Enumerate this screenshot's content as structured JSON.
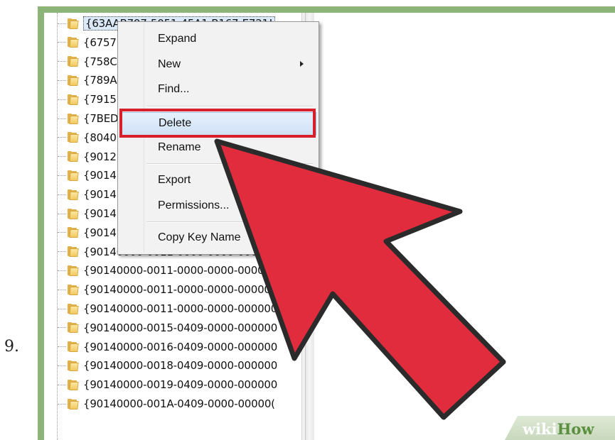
{
  "step_number": "9.",
  "registry_tree": {
    "rows": [
      {
        "label": "{63AAB797-5051-45A1-B167-E721!",
        "selected": true
      },
      {
        "label": "{6757!"
      },
      {
        "label": "{758C"
      },
      {
        "label": "{789A"
      },
      {
        "label": "{7915!"
      },
      {
        "label": "{7BED"
      },
      {
        "label": "{8040"
      },
      {
        "label": "{9012("
      },
      {
        "label": "{9014("
      },
      {
        "label": "{9014("
      },
      {
        "label": "{9014("
      },
      {
        "label": "{9014("
      },
      {
        "label": "{90140000-0011-0000-0000-0000"
      },
      {
        "label": "{90140000-0011-0000-0000-00000"
      },
      {
        "label": "{90140000-0011-0000-0000-000000"
      },
      {
        "label": "{90140000-0011-0000-0000-000000"
      },
      {
        "label": "{90140000-0015-0409-0000-000000"
      },
      {
        "label": "{90140000-0016-0409-0000-000000"
      },
      {
        "label": "{90140000-0018-0409-0000-000000"
      },
      {
        "label": "{90140000-0019-0409-0000-000000"
      },
      {
        "label": "{90140000-001A-0409-0000-00000("
      }
    ]
  },
  "context_menu": {
    "items": {
      "expand": "Expand",
      "new": "New",
      "find": "Find...",
      "delete": "Delete",
      "rename": "Rename",
      "export": "Export",
      "permissions": "Permissions...",
      "copy_key_name": "Copy Key Name"
    },
    "highlighted_item": "Delete"
  },
  "annotation": {
    "highlight_color": "#d6202c",
    "arrow_color": "#e02c3d"
  },
  "watermark": {
    "part1": "wiki",
    "part2": "How"
  },
  "colors": {
    "frame_green": "#8db57a",
    "folder_yellow": "#f2c862",
    "menu_hover_blue": "#cfe2f6"
  }
}
